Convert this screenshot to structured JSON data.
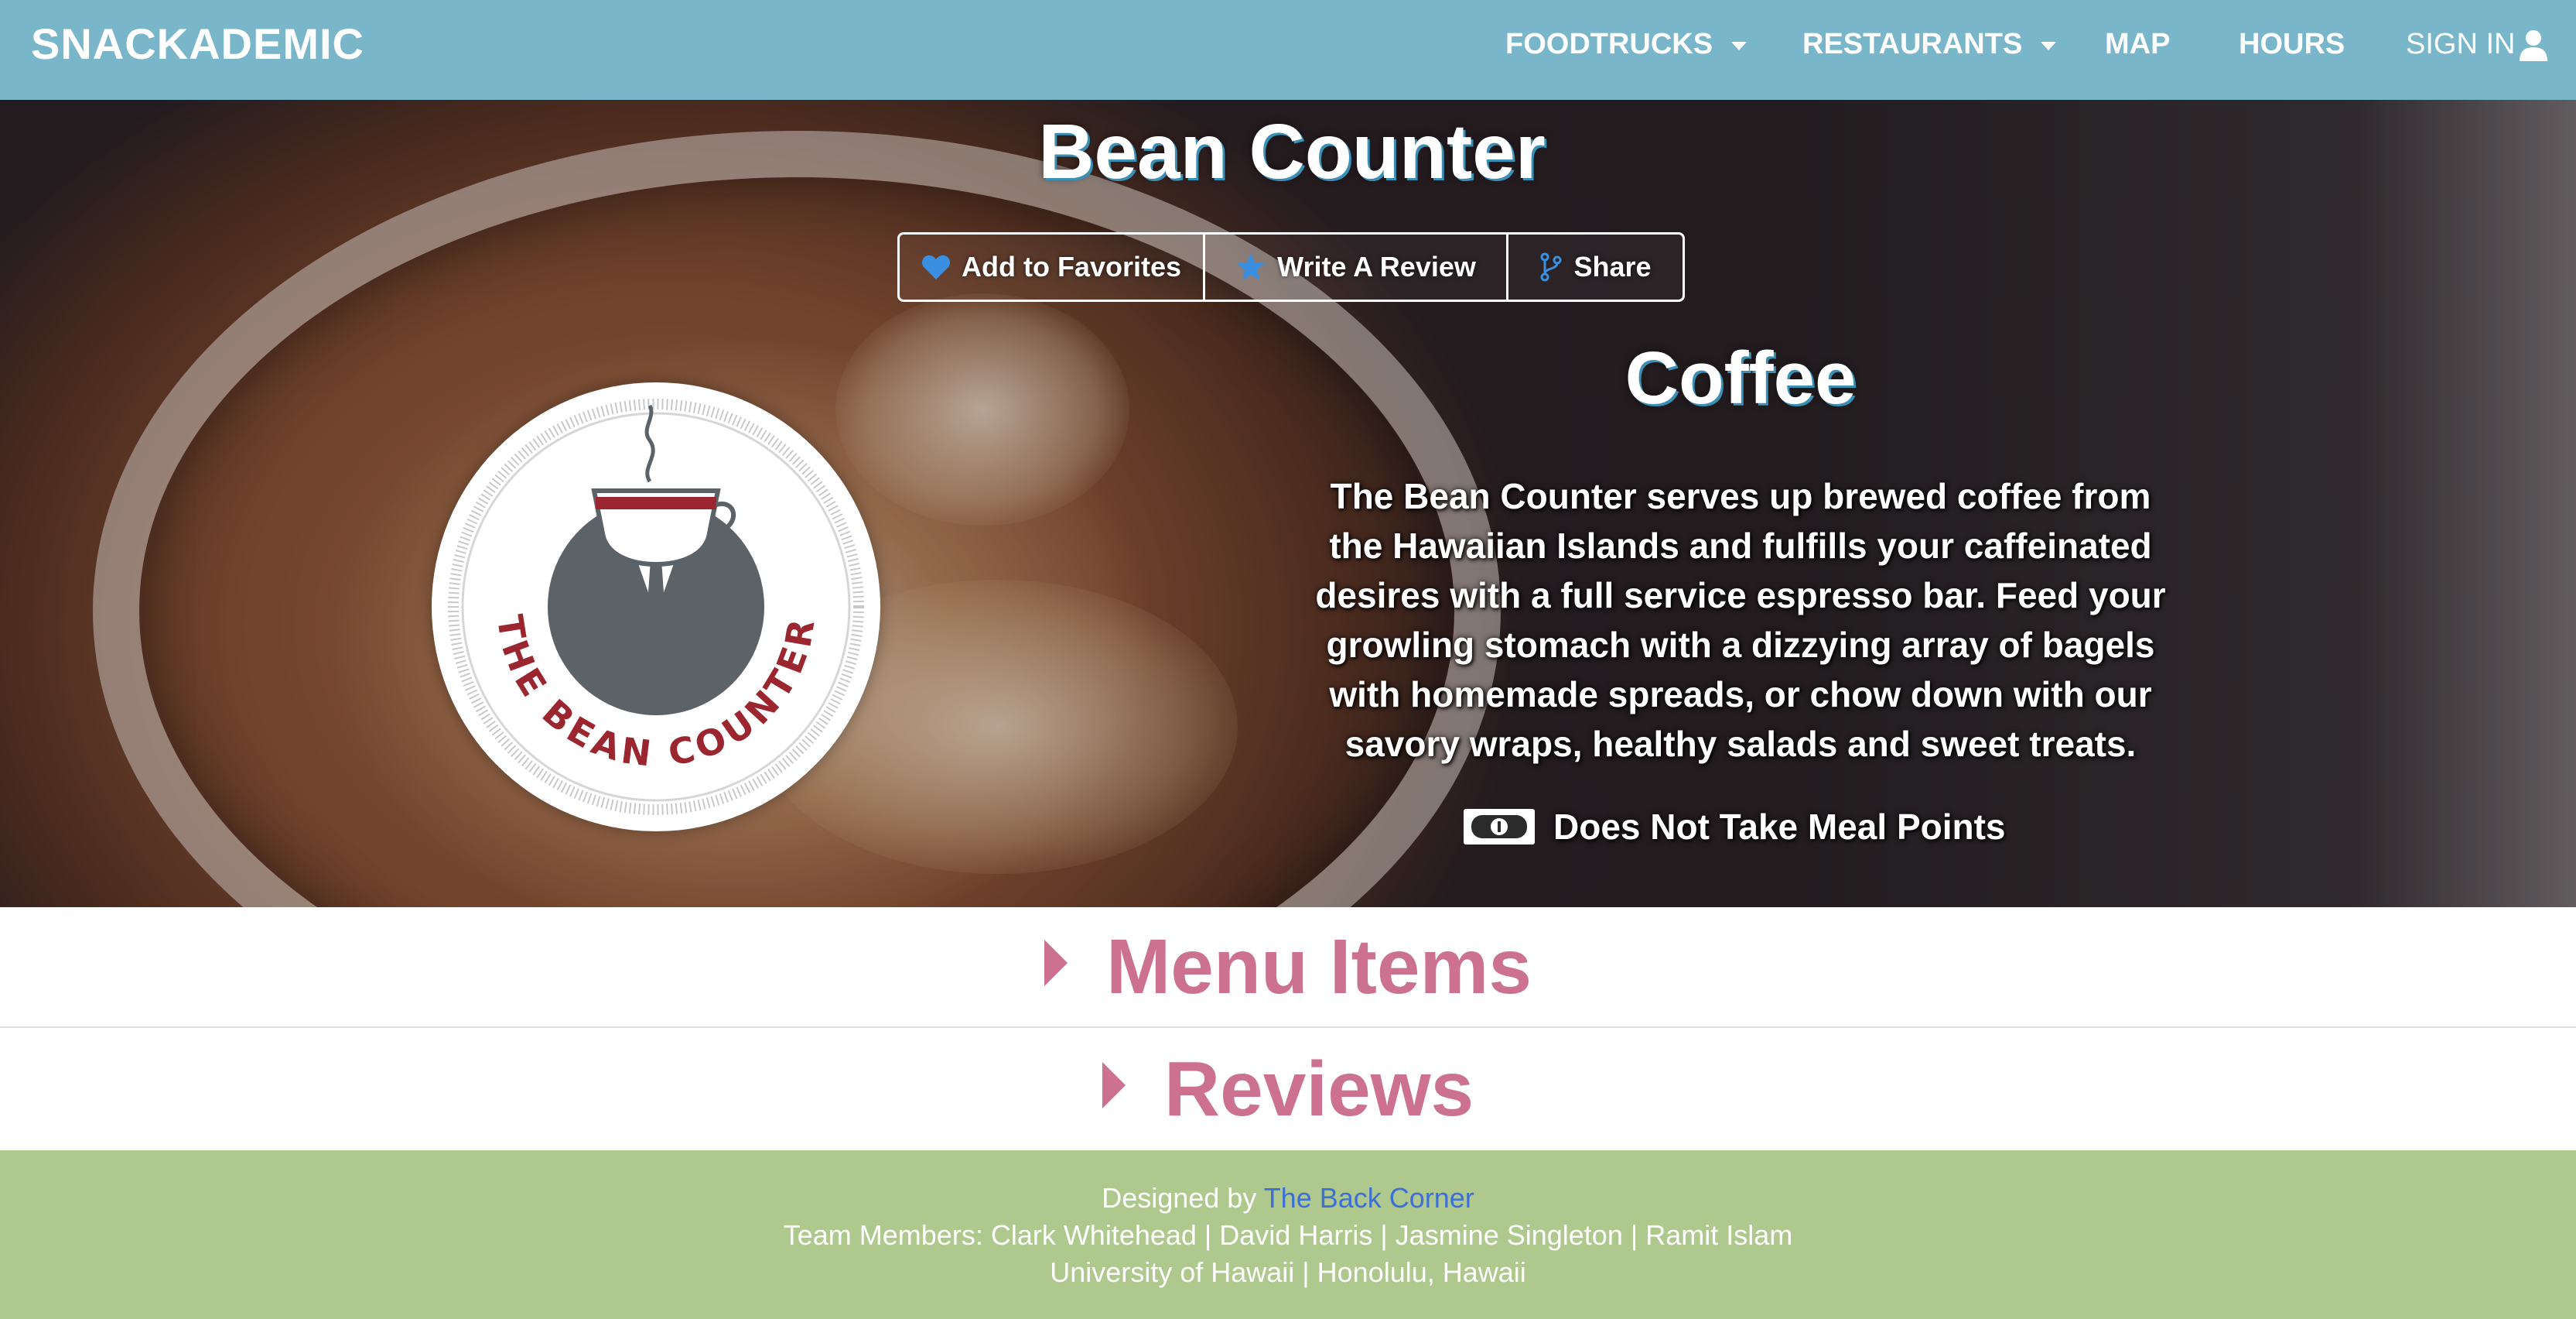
{
  "navbar": {
    "brand": "SNACKADEMIC",
    "items": [
      {
        "label": "FOODTRUCKS",
        "dropdown": true
      },
      {
        "label": "RESTAURANTS",
        "dropdown": true
      },
      {
        "label": "MAP",
        "dropdown": false
      },
      {
        "label": "HOURS",
        "dropdown": false
      }
    ],
    "sign_in": "SIGN IN",
    "color": "#79b6c9"
  },
  "vendor": {
    "name": "Bean Counter",
    "category": "Coffee",
    "description": "The Bean Counter serves up brewed coffee from the Hawaiian Islands and fulfills your caffeinated desires with a full service espresso bar. Feed your growling stomach with a dizzying array of bagels with homemade spreads, or chow down with our savory wraps, healthy salads and sweet treats.",
    "meal_points": "Does Not Take Meal Points",
    "logo_text": "THE BEAN COUNTER"
  },
  "actions": {
    "favorites": "Add to Favorites",
    "review": "Write A Review",
    "share": "Share"
  },
  "sections": {
    "menu": "Menu Items",
    "reviews": "Reviews",
    "accent": "#cc7190"
  },
  "footer": {
    "designed_by_prefix": "Designed by",
    "designed_by_link": "The Back Corner",
    "team": "Team Members: Clark Whitehead | David Harris | Jasmine Singleton | Ramit Islam",
    "location": "University of Hawaii | Honolulu, Hawaii",
    "color": "#aec88e"
  }
}
